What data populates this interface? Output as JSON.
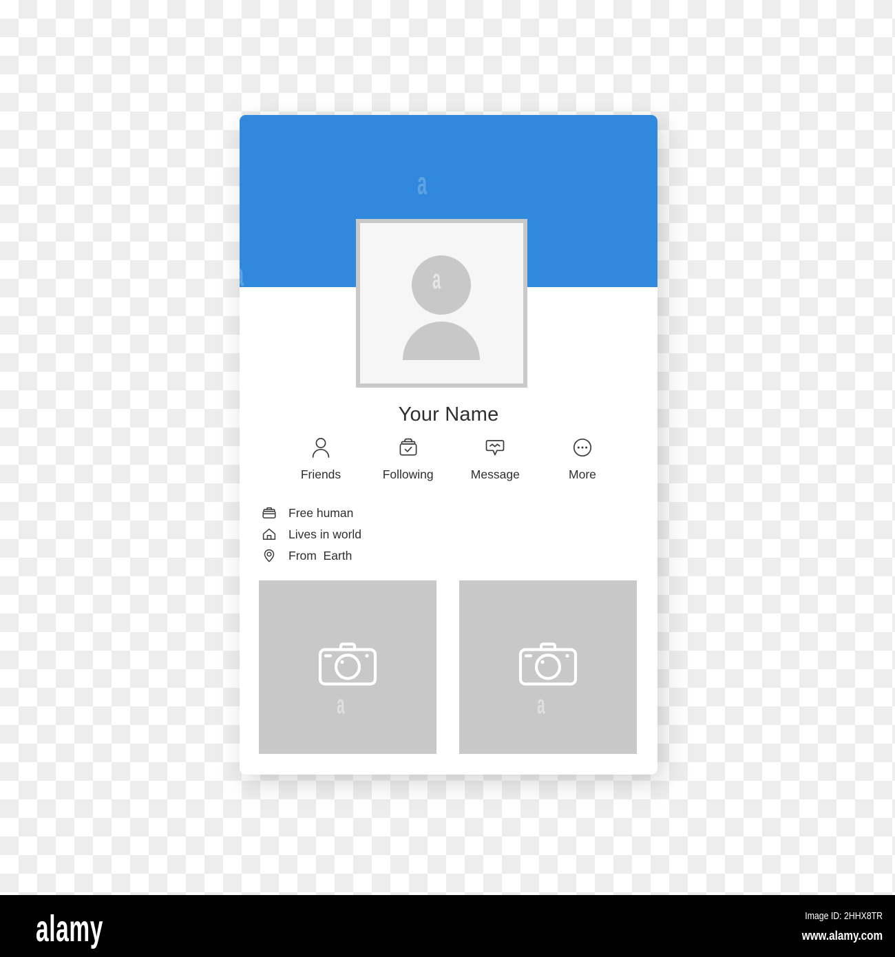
{
  "card": {
    "cover_color": "#3089dc",
    "background_color": "#ffffff",
    "avatar": {
      "icon": "user-avatar-placeholder-icon",
      "frame_color": "#c9c9c9",
      "fill_color": "#f6f6f6",
      "figure_color": "#c8c8c8"
    },
    "profile_name": "Your Name",
    "actions": [
      {
        "icon": "person-icon",
        "label": "Friends"
      },
      {
        "icon": "briefcase-check-icon",
        "label": "Following"
      },
      {
        "icon": "chat-bubble-icon",
        "label": "Message"
      },
      {
        "icon": "ellipsis-circle-icon",
        "label": "More"
      }
    ],
    "info": [
      {
        "icon": "briefcase-icon",
        "text": "Free human"
      },
      {
        "icon": "home-icon",
        "text": "Lives in world"
      },
      {
        "icon": "location-pin-icon",
        "text": "From  Earth"
      }
    ],
    "photos": [
      {
        "icon": "camera-icon",
        "placeholder_color": "#c8c8c8"
      },
      {
        "icon": "camera-icon",
        "placeholder_color": "#c8c8c8"
      }
    ]
  },
  "footer": {
    "logo": "alamy",
    "image_id": "Image ID: 2HHX8TR",
    "url": "www.alamy.com",
    "background_color": "#000000",
    "text_color": "#ffffff"
  },
  "watermark": {
    "glyph": "a"
  }
}
